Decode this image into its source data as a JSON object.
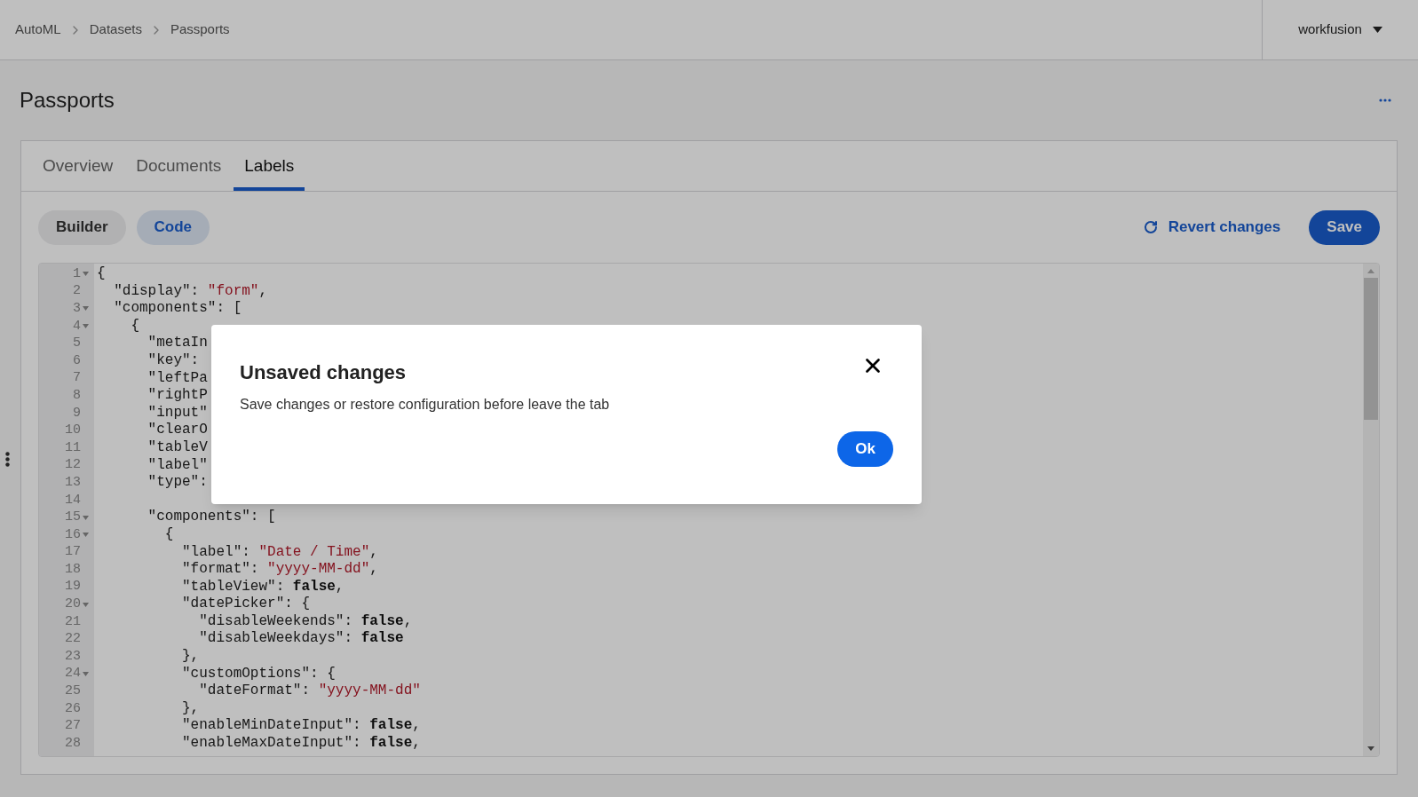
{
  "breadcrumb": [
    "AutoML",
    "Datasets",
    "Passports"
  ],
  "account": {
    "name": "workfusion"
  },
  "page": {
    "title": "Passports"
  },
  "tabs": [
    {
      "label": "Overview",
      "selected": false
    },
    {
      "label": "Documents",
      "selected": false
    },
    {
      "label": "Labels",
      "selected": true
    }
  ],
  "mode_toggle": [
    {
      "label": "Builder",
      "selected": false
    },
    {
      "label": "Code",
      "selected": true
    }
  ],
  "actions": {
    "revert": "Revert changes",
    "save": "Save"
  },
  "code_lines": [
    {
      "n": "1",
      "fold": true,
      "seg": [
        {
          "kind": "punct",
          "t": "{"
        }
      ]
    },
    {
      "n": "2",
      "fold": false,
      "seg": [
        {
          "kind": "key",
          "t": "  \"display\": "
        },
        {
          "kind": "string",
          "t": "\"form\""
        },
        {
          "kind": "punct",
          "t": ","
        }
      ]
    },
    {
      "n": "3",
      "fold": true,
      "seg": [
        {
          "kind": "key",
          "t": "  \"components\": ["
        }
      ]
    },
    {
      "n": "4",
      "fold": true,
      "seg": [
        {
          "kind": "punct",
          "t": "    {"
        }
      ]
    },
    {
      "n": "5",
      "fold": false,
      "seg": [
        {
          "kind": "key",
          "t": "      \"metaIn"
        }
      ]
    },
    {
      "n": "6",
      "fold": false,
      "seg": [
        {
          "kind": "key",
          "t": "      \"key\": "
        }
      ]
    },
    {
      "n": "7",
      "fold": false,
      "seg": [
        {
          "kind": "key",
          "t": "      \"leftPa"
        }
      ]
    },
    {
      "n": "8",
      "fold": false,
      "seg": [
        {
          "kind": "key",
          "t": "      \"rightP"
        }
      ]
    },
    {
      "n": "9",
      "fold": false,
      "seg": [
        {
          "kind": "key",
          "t": "      \"input\""
        }
      ]
    },
    {
      "n": "10",
      "fold": false,
      "seg": [
        {
          "kind": "key",
          "t": "      \"clearO"
        }
      ]
    },
    {
      "n": "11",
      "fold": false,
      "seg": [
        {
          "kind": "key",
          "t": "      \"tableV"
        }
      ]
    },
    {
      "n": "12",
      "fold": false,
      "seg": [
        {
          "kind": "key",
          "t": "      \"label\""
        }
      ]
    },
    {
      "n": "13",
      "fold": false,
      "seg": [
        {
          "kind": "key",
          "t": "      \"type\":"
        }
      ]
    },
    {
      "n": "14",
      "fold": false
    },
    {
      "n": "15",
      "fold": true,
      "seg": [
        {
          "kind": "key",
          "t": "      \"components\": ["
        }
      ]
    },
    {
      "n": "16",
      "fold": true,
      "seg": [
        {
          "kind": "punct",
          "t": "        {"
        }
      ]
    },
    {
      "n": "17",
      "fold": false,
      "seg": [
        {
          "kind": "key",
          "t": "          \"label\": "
        },
        {
          "kind": "string",
          "t": "\"Date / Time\""
        },
        {
          "kind": "punct",
          "t": ","
        }
      ]
    },
    {
      "n": "18",
      "fold": false,
      "seg": [
        {
          "kind": "key",
          "t": "          \"format\": "
        },
        {
          "kind": "string",
          "t": "\"yyyy-MM-dd\""
        },
        {
          "kind": "punct",
          "t": ","
        }
      ]
    },
    {
      "n": "19",
      "fold": false,
      "seg": [
        {
          "kind": "key",
          "t": "          \"tableView\": "
        },
        {
          "kind": "keyword",
          "t": "false"
        },
        {
          "kind": "punct",
          "t": ","
        }
      ]
    },
    {
      "n": "20",
      "fold": true,
      "seg": [
        {
          "kind": "key",
          "t": "          \"datePicker\": {"
        }
      ]
    },
    {
      "n": "21",
      "fold": false,
      "seg": [
        {
          "kind": "key",
          "t": "            \"disableWeekends\": "
        },
        {
          "kind": "keyword",
          "t": "false"
        },
        {
          "kind": "punct",
          "t": ","
        }
      ]
    },
    {
      "n": "22",
      "fold": false,
      "seg": [
        {
          "kind": "key",
          "t": "            \"disableWeekdays\": "
        },
        {
          "kind": "keyword",
          "t": "false"
        }
      ]
    },
    {
      "n": "23",
      "fold": false,
      "seg": [
        {
          "kind": "punct",
          "t": "          },"
        }
      ]
    },
    {
      "n": "24",
      "fold": true,
      "seg": [
        {
          "kind": "key",
          "t": "          \"customOptions\": {"
        }
      ]
    },
    {
      "n": "25",
      "fold": false,
      "seg": [
        {
          "kind": "key",
          "t": "            \"dateFormat\": "
        },
        {
          "kind": "string",
          "t": "\"yyyy-MM-dd\""
        }
      ]
    },
    {
      "n": "26",
      "fold": false,
      "seg": [
        {
          "kind": "punct",
          "t": "          },"
        }
      ]
    },
    {
      "n": "27",
      "fold": false,
      "seg": [
        {
          "kind": "key",
          "t": "          \"enableMinDateInput\": "
        },
        {
          "kind": "keyword",
          "t": "false"
        },
        {
          "kind": "punct",
          "t": ","
        }
      ]
    },
    {
      "n": "28",
      "fold": false,
      "seg": [
        {
          "kind": "key",
          "t": "          \"enableMaxDateInput\": "
        },
        {
          "kind": "keyword",
          "t": "false"
        },
        {
          "kind": "punct",
          "t": ","
        }
      ]
    }
  ],
  "dialog": {
    "title": "Unsaved changes",
    "message": "Save changes or restore configuration before leave the tab",
    "ok": "Ok"
  }
}
